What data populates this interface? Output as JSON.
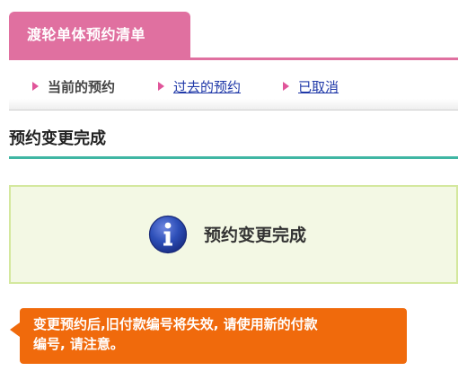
{
  "header": {
    "tab_title": "渡轮单体预约清单"
  },
  "subnav": {
    "items": [
      {
        "label": "当前的预约",
        "active": true
      },
      {
        "label": "过去的预约",
        "active": false
      },
      {
        "label": "已取消",
        "active": false
      }
    ]
  },
  "section": {
    "title": "预约变更完成"
  },
  "notice": {
    "icon": "info-icon",
    "message": "预约变更完成"
  },
  "warning": {
    "line1": "变更预约后,旧付款编号将失效, 请使用新的付款",
    "line2": "编号, 请注意。"
  },
  "colors": {
    "tab_pink": "#e070a0",
    "nav_triangle": "#e0559a",
    "teal_rule": "#3fb6a3",
    "notice_bg": "#f3f8e4",
    "notice_border": "#d4e89e",
    "warning_orange": "#f06a0c",
    "link_blue": "#1f38a8"
  }
}
